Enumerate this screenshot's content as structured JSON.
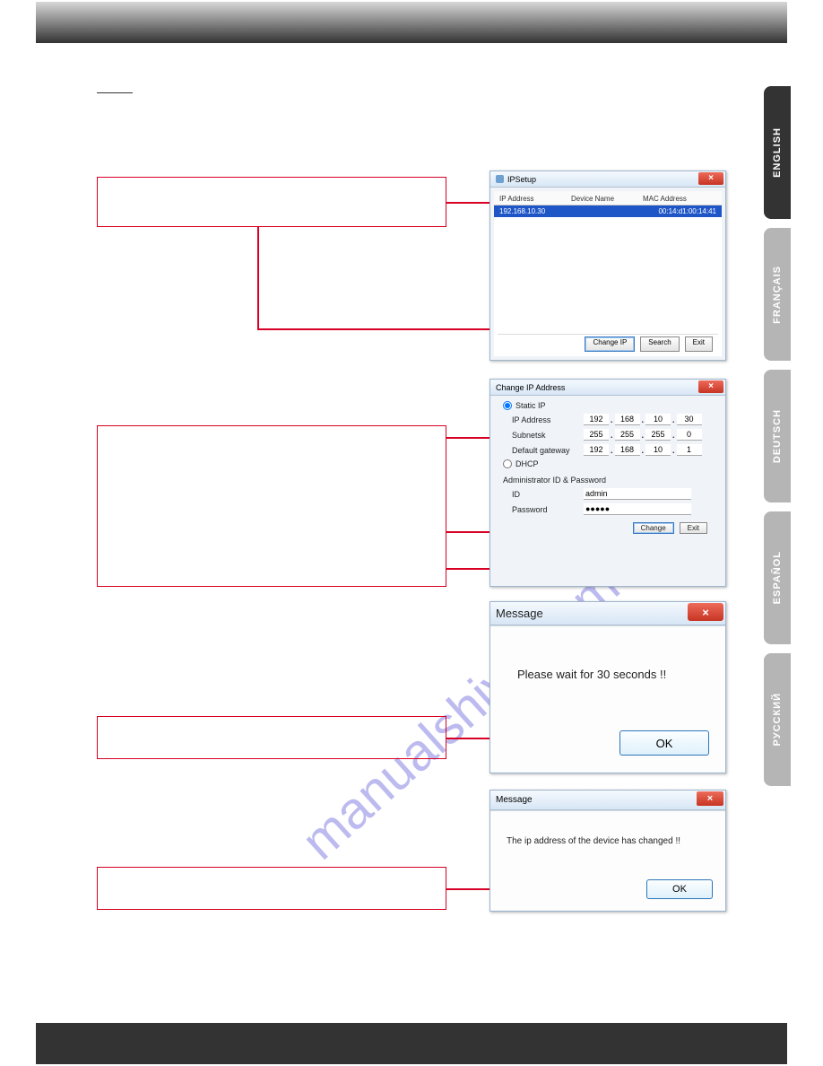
{
  "languages": {
    "en": "ENGLISH",
    "fr": "FRANÇAIS",
    "de": "DEUTSCH",
    "es": "ESPAÑOL",
    "ru": "РУССКИЙ"
  },
  "watermark": "manualshive.com",
  "ipsetup": {
    "title": "IPSetup",
    "columns": {
      "ip": "IP Address",
      "name": "Device Name",
      "mac": "MAC Address"
    },
    "row": {
      "ip": "192.168.10.30",
      "name": "",
      "mac": "00:14:d1:00:14:41"
    },
    "buttons": {
      "change": "Change IP",
      "search": "Search",
      "exit": "Exit"
    }
  },
  "changeip": {
    "title": "Change IP Address",
    "static_label": "Static IP",
    "dhcp_label": "DHCP",
    "labels": {
      "ip": "IP Address",
      "subnet": "Subnetsk",
      "gateway": "Default gateway"
    },
    "ip": [
      "192",
      "168",
      "10",
      "30"
    ],
    "subnet": [
      "255",
      "255",
      "255",
      "0"
    ],
    "gateway": [
      "192",
      "168",
      "10",
      "1"
    ],
    "auth_section": "Administrator ID & Password",
    "id_label": "ID",
    "pw_label": "Password",
    "id_value": "admin",
    "pw_value": "●●●●●",
    "buttons": {
      "change": "Change",
      "exit": "Exit"
    }
  },
  "msg1": {
    "title": "Message",
    "text": "Please wait for 30 seconds !!",
    "ok": "OK"
  },
  "msg2": {
    "title": "Message",
    "text": "The ip address of the device has changed !!",
    "ok": "OK"
  }
}
